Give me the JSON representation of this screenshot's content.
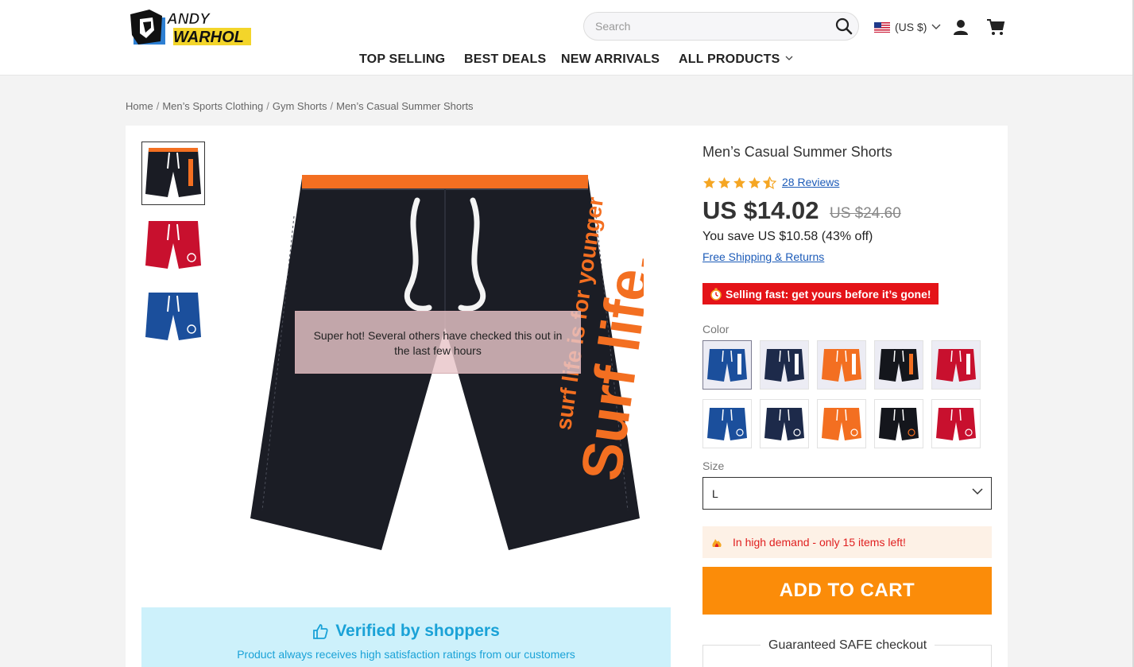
{
  "header": {
    "logo_text": "ANDY WARHOL",
    "search": {
      "placeholder": "Search",
      "value": ""
    },
    "currency_label": "(US $)",
    "nav": [
      {
        "label": "TOP SELLING"
      },
      {
        "label": "BEST DEALS"
      },
      {
        "label": "NEW ARRIVALS"
      },
      {
        "label": "ALL PRODUCTS"
      }
    ]
  },
  "breadcrumb": [
    "Home",
    "Men’s Sports Clothing",
    "Gym Shorts",
    "Men’s Casual Summer Shorts"
  ],
  "gallery": {
    "thumbnails": [
      {
        "color": "black",
        "accent": "#f36f21"
      },
      {
        "color": "red",
        "accent": "#ffffff"
      },
      {
        "color": "blue",
        "accent": "#ffffff"
      }
    ],
    "main_image_print": "surf life is for younger  Surf life.",
    "tooltip": "Super hot! Several others have checked this out in the last few hours"
  },
  "verified": {
    "title": "Verified by shoppers",
    "subtitle": "Product always receives high satisfaction ratings from our customers"
  },
  "product": {
    "title": "Men’s Casual Summer Shorts",
    "rating": 4.5,
    "reviews_label": "28 Reviews",
    "price": "US $14.02",
    "old_price": "US $24.60",
    "savings": "You save US $10.58 (43% off)",
    "shipping_link": "Free Shipping & Returns",
    "selling_fast": "Selling fast: get yours before it’s gone!",
    "color_label": "Color",
    "colors_row1": [
      "#1b4f9c",
      "#1d2a4a",
      "#f36f21",
      "#14161c",
      "#c8102e"
    ],
    "colors_row2": [
      "#1b4f9c",
      "#1d2a4a",
      "#f36f21",
      "#14161c",
      "#c8102e"
    ],
    "size_label": "Size",
    "size_value": "L",
    "demand": "In high demand - only 15 items left!",
    "add_to_cart": "ADD TO CART",
    "safe_checkout": "Guaranteed SAFE checkout"
  },
  "colors": {
    "accent_orange": "#fb8c09",
    "alert_red": "#e41318",
    "link_blue": "#1c5bb8",
    "verified_blue": "#1aa2d7",
    "star_gold": "#f5a623"
  },
  "icons": [
    "search-icon",
    "us-flag-icon",
    "chevron-down-icon",
    "user-icon",
    "cart-icon",
    "star-icon",
    "stopwatch-icon",
    "flame-icon",
    "thumbs-up-icon"
  ]
}
